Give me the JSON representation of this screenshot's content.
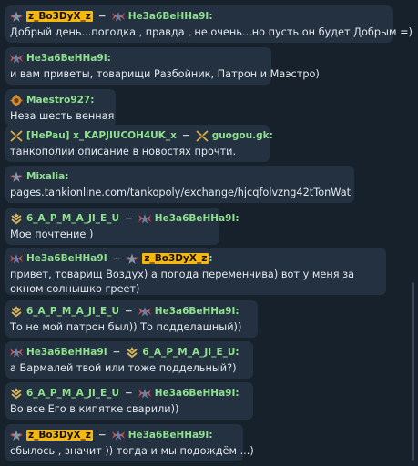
{
  "messages": [
    {
      "sender": "z_Bo3DyX_z",
      "sender_highlight": true,
      "sender_color": "#f6b80c",
      "sender_rank": "private-star-icon",
      "recipient": "He3a6BeHHa9I",
      "recipient_color": "#8fe08f",
      "recipient_rank": "marshal-wings-icon",
      "text": "Добрый день...погодка , правда , не очень...но пусть он будет Добрым =)"
    },
    {
      "sender": "He3a6BeHHa9I",
      "sender_color": "#8fe08f",
      "sender_rank": "marshal-wings-icon",
      "text": "и вам приветы, товарищи Разбойник, Патрон и Маэстро)"
    },
    {
      "sender": "Maestro927",
      "sender_suffix": ":",
      "sender_color": "#8fe08f",
      "sender_rank": "gear-rank-icon",
      "text": "Неза шесть венная"
    },
    {
      "sender": "[HePau] x_KAPJIUCOH4UK_x",
      "sender_color": "#8fe08f",
      "sender_rank": "crossed-swords-rank-icon",
      "recipient": "guogou.gk",
      "recipient_suffix": ":",
      "recipient_color": "#8fe08f",
      "recipient_rank": "crossed-swords-rank-icon",
      "text": "танкополии описание в новостях прочти."
    },
    {
      "sender": "Mixalia",
      "sender_suffix": ":",
      "sender_color": "#8fe08f",
      "sender_rank": "private-star-icon",
      "text": "pages.tankionline.com/tankopoly/exchange/hjcqfolvzng42tTonWat"
    },
    {
      "sender": "6_A_P_M_A_JI_E_U",
      "sender_color": "#8fe08f",
      "sender_rank": "chevron-rank-icon",
      "recipient": "He3a6BeHHa9I",
      "recipient_color": "#8fe08f",
      "recipient_rank": "marshal-wings-icon",
      "text": "Мое почтение )"
    },
    {
      "sender": "He3a6BeHHa9I",
      "sender_color": "#8fe08f",
      "sender_rank": "marshal-wings-icon",
      "recipient": "z_Bo3DyX_z",
      "recipient_highlight": true,
      "recipient_color": "#f6b80c",
      "recipient_rank": "private-star-icon",
      "text": "привет, товарищ Воздух) а погода переменчива) вот у меня за окном солнышко греет)"
    },
    {
      "sender": "6_A_P_M_A_JI_E_U",
      "sender_color": "#8fe08f",
      "sender_rank": "chevron-rank-icon",
      "recipient": "He3a6BeHHa9I",
      "recipient_color": "#8fe08f",
      "recipient_rank": "marshal-wings-icon",
      "text": "То не мой патрон был)) То подделашный))"
    },
    {
      "sender": "He3a6BeHHa9I",
      "sender_color": "#8fe08f",
      "sender_rank": "marshal-wings-icon",
      "recipient": "6_A_P_M_A_JI_E_U",
      "recipient_color": "#8fe08f",
      "recipient_rank": "chevron-rank-icon",
      "text": "а Бармалей твой или тоже поддельный?)"
    },
    {
      "sender": "6_A_P_M_A_JI_E_U",
      "sender_color": "#8fe08f",
      "sender_rank": "chevron-rank-icon",
      "recipient": "He3a6BeHHa9I",
      "recipient_color": "#8fe08f",
      "recipient_rank": "marshal-wings-icon",
      "text": "Во все Его в кипятке сварили))"
    },
    {
      "sender": "z_Bo3DyX_z",
      "sender_highlight": true,
      "sender_color": "#f6b80c",
      "sender_rank": "private-star-icon",
      "recipient": "He3a6BeHHa9I",
      "recipient_color": "#8fe08f",
      "recipient_rank": "marshal-wings-icon",
      "text": "сбылось , значит )) тогда и мы подождём ...)"
    }
  ],
  "separator": "−",
  "default_suffix": ":"
}
